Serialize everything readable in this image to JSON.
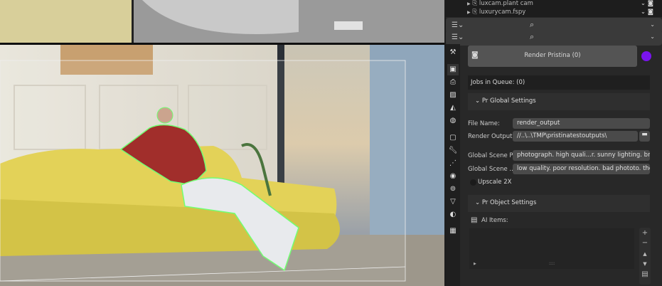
{
  "outliner": {
    "items": [
      {
        "label": "luxcam.plant cam"
      },
      {
        "label": "luxurycam.fspy"
      }
    ]
  },
  "properties": {
    "render_button": "Render Pristina (0)",
    "status_color": "#7a14f0",
    "jobs_in_queue": "Jobs in Queue: (0)",
    "global_section": "Pr Global Settings",
    "file_name_label": "File Name:",
    "file_name_value": "render_output",
    "render_output_label": "Render Output:",
    "render_output_value": "//..\\..\\TMP\\pristinatestoutputs\\",
    "global_prompt_label": "Global Scene P...",
    "global_prompt_value": "photograph. high quali...r. sunny lighting. bright.",
    "global_negative_label": "Global Scene ...",
    "global_negative_value": "low quality. poor resolution. bad phototo. the s...",
    "upscale_label": "Upscale 2X",
    "object_section": "Pr Object Settings",
    "ai_items_label": "AI Items:"
  }
}
